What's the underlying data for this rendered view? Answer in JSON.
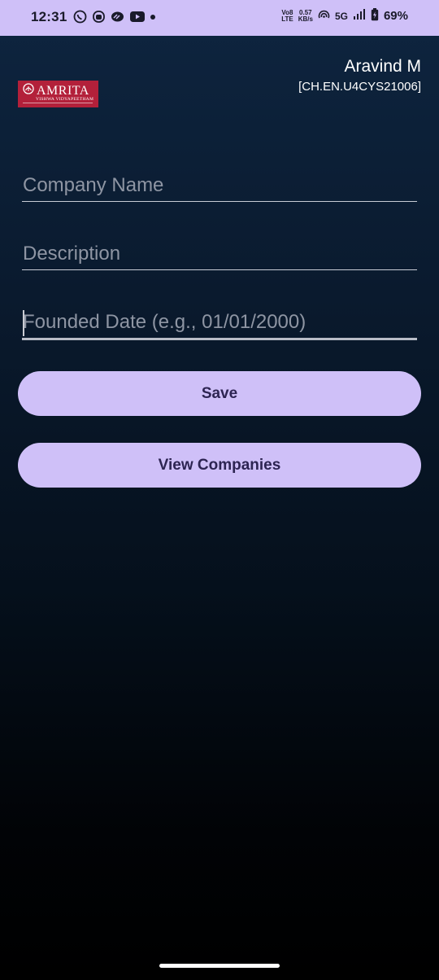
{
  "status_bar": {
    "time": "12:31",
    "volte": "Vo8",
    "lte": "LTE",
    "speed_value": "0.57",
    "speed_unit": "KB/s",
    "network": "5G",
    "battery": "69%",
    "icons": [
      "whatsapp-icon",
      "instagram-icon",
      "app-icon",
      "youtube-icon",
      "dot-icon",
      "hotspot-icon",
      "signal-icon",
      "battery-charging-icon"
    ]
  },
  "header": {
    "logo_text": "AMRITA",
    "logo_subtext": "VISHWA VIDYAPEETHAM",
    "user_name": "Aravind M",
    "user_id": "[CH.EN.U4CYS21006]"
  },
  "form": {
    "company_name_placeholder": "Company Name",
    "description_placeholder": "Description",
    "founded_date_placeholder": "Founded Date (e.g., 01/01/2000)"
  },
  "buttons": {
    "save_label": "Save",
    "view_companies_label": "View Companies"
  },
  "colors": {
    "accent": "#cfc0f8",
    "button_text": "#2d2452",
    "logo_bg": "#b3203a"
  }
}
